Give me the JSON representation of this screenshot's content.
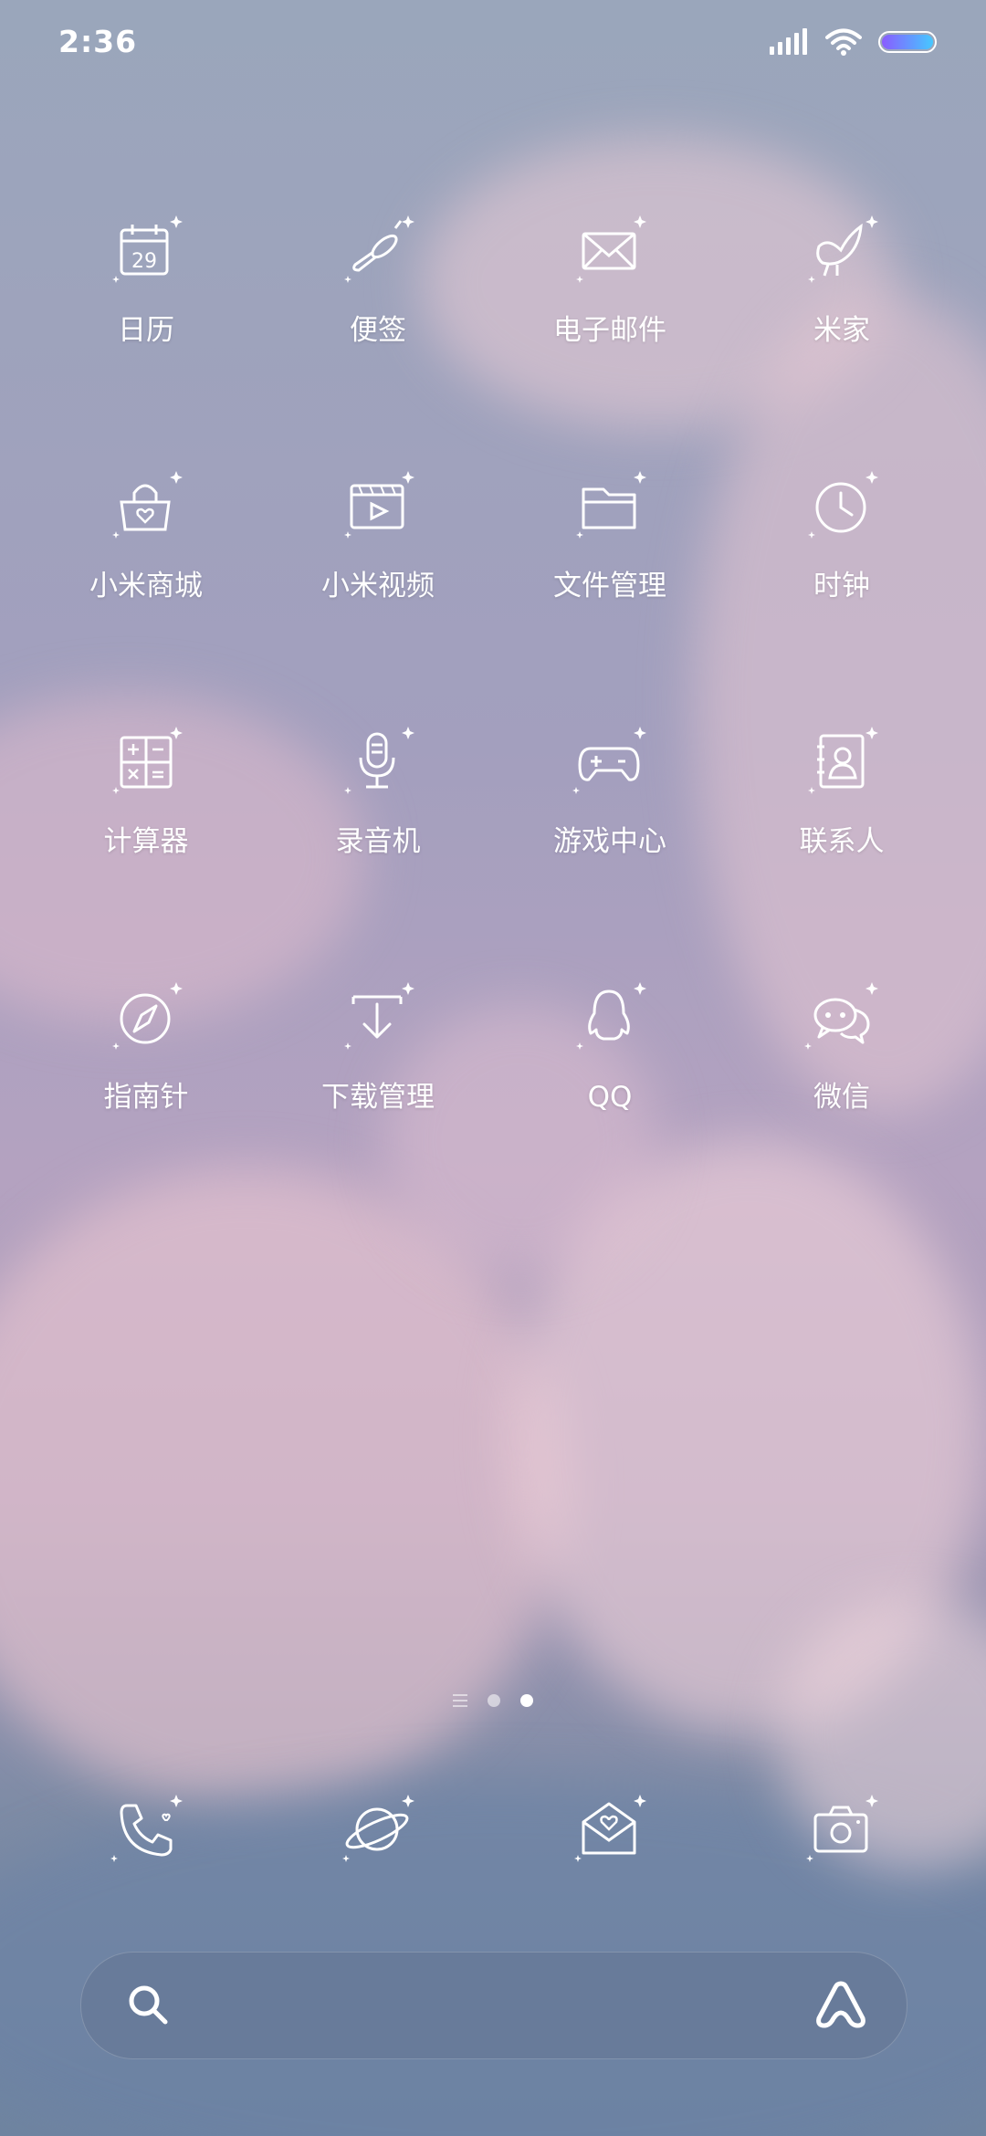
{
  "status_bar": {
    "time": "2:36",
    "battery_color": "#7c6cf0",
    "icons": [
      "signal-icon",
      "wifi-icon",
      "battery-icon"
    ]
  },
  "apps": [
    {
      "label": "日历",
      "icon": "calendar-icon",
      "calendar_day": "29"
    },
    {
      "label": "便签",
      "icon": "notes-icon"
    },
    {
      "label": "电子邮件",
      "icon": "email-icon"
    },
    {
      "label": "米家",
      "icon": "mijia-icon"
    },
    {
      "label": "小米商城",
      "icon": "shopping-bag-icon"
    },
    {
      "label": "小米视频",
      "icon": "video-icon"
    },
    {
      "label": "文件管理",
      "icon": "folder-icon"
    },
    {
      "label": "时钟",
      "icon": "clock-icon"
    },
    {
      "label": "计算器",
      "icon": "calculator-icon"
    },
    {
      "label": "录音机",
      "icon": "microphone-icon"
    },
    {
      "label": "游戏中心",
      "icon": "gamepad-icon"
    },
    {
      "label": "联系人",
      "icon": "contacts-icon"
    },
    {
      "label": "指南针",
      "icon": "compass-icon"
    },
    {
      "label": "下载管理",
      "icon": "download-icon"
    },
    {
      "label": "QQ",
      "icon": "qq-icon"
    },
    {
      "label": "微信",
      "icon": "wechat-icon"
    }
  ],
  "page_indicator": {
    "pages": 2,
    "active_index": 1
  },
  "dock": [
    {
      "icon": "phone-icon"
    },
    {
      "icon": "browser-planet-icon"
    },
    {
      "icon": "messages-icon"
    },
    {
      "icon": "camera-icon"
    }
  ],
  "search_bar": {
    "search_icon": "search-icon",
    "assistant_icon": "assistant-a-icon"
  }
}
